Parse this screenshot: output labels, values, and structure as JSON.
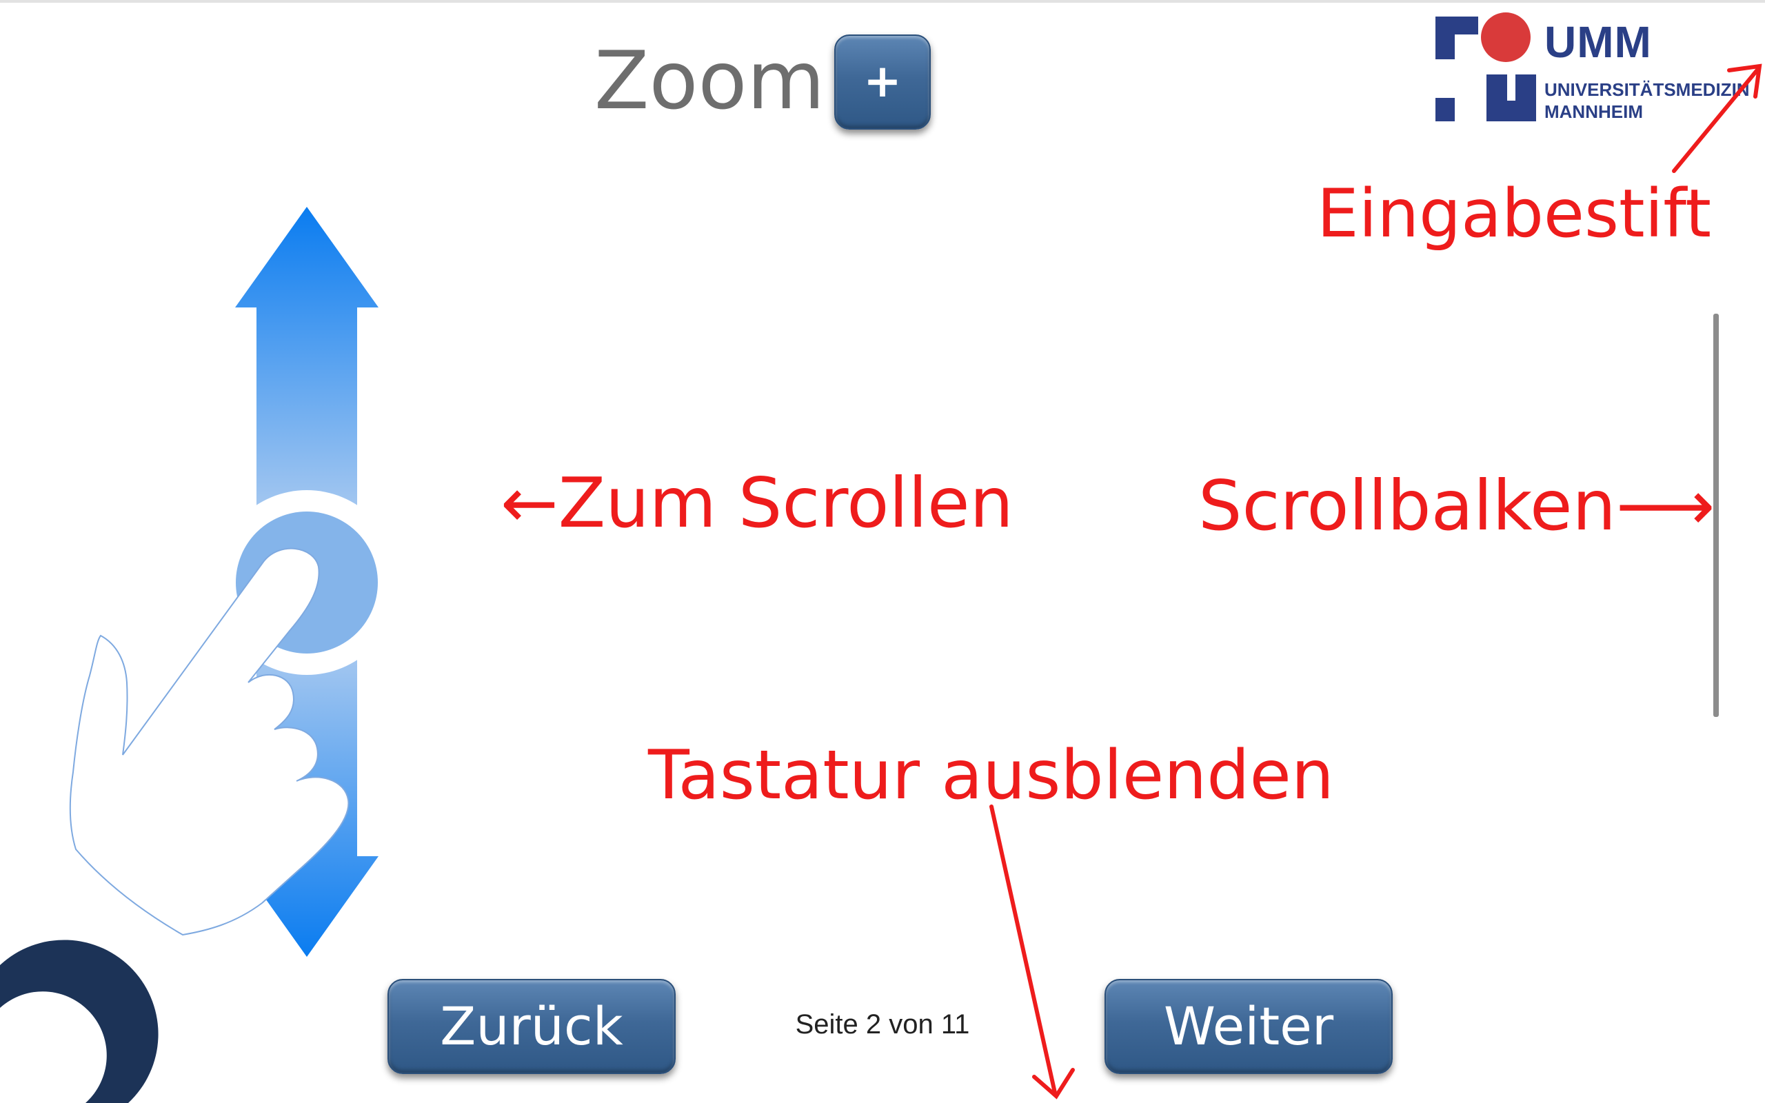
{
  "zoom": {
    "label": "Zoom",
    "plus_label": "+"
  },
  "logo": {
    "short": "UMM",
    "line1": "UNIVERSITÄTSMEDIZIN",
    "line2": "MANNHEIM",
    "colors": {
      "blue": "#2a3f86",
      "red": "#d93a3a"
    }
  },
  "annotations": {
    "pen": "Eingabestift",
    "scroll_gesture": "←Zum Scrollen",
    "scrollbar": "Scrollbalken⟶",
    "keyboard": "Tastatur ausblenden"
  },
  "navigation": {
    "back_label": "Zurück",
    "next_label": "Weiter",
    "page_indicator": "Seite 2 von 11"
  },
  "icons": {
    "scroll_gesture": "hand-swipe-vertical-icon",
    "loading": "spinner-ring-icon"
  },
  "colors": {
    "annotation_red": "#ee1c1c",
    "button_blue": "#3f6897",
    "arrow_blue": "#1080f0"
  }
}
